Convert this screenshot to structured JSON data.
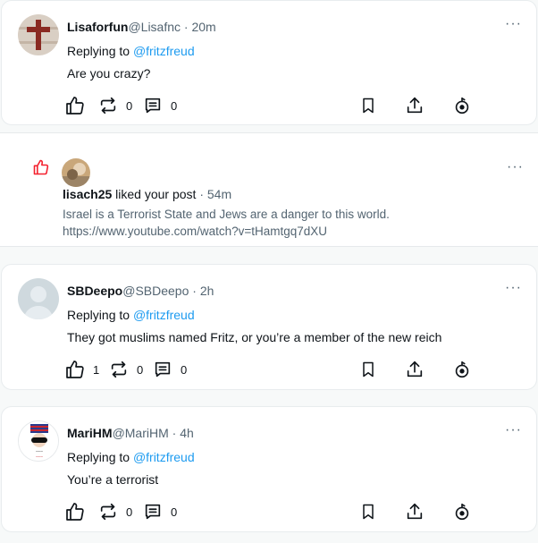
{
  "posts": [
    {
      "name": "Lisaforfun",
      "handle": "@Lisafnc",
      "time": "· 20m",
      "replying_prefix": "Replying to ",
      "replying_to": "@fritzfreud",
      "text": "Are you crazy?",
      "likes": "",
      "reposts": "0",
      "replies": "0",
      "avatar": "cross-avatar"
    },
    {
      "name": "SBDeepo",
      "handle": "@SBDeepo",
      "time": "· 2h",
      "replying_prefix": "Replying to ",
      "replying_to": "@fritzfreud",
      "text": "They got muslims named Fritz, or you’re a member of the new reich",
      "likes": "1",
      "reposts": "0",
      "replies": "0",
      "avatar": "default-avatar"
    },
    {
      "name": "MariHM",
      "handle": "@MariHM",
      "time": "· 4h",
      "replying_prefix": "Replying to ",
      "replying_to": "@fritzfreud",
      "text": "You’re a terrorist",
      "likes": "",
      "reposts": "0",
      "replies": "0",
      "avatar": "flag-avatar"
    }
  ],
  "notification": {
    "user": "lisach25",
    "action": " liked your post",
    "time": " · 54m",
    "body_line1": "Israel is a Terrorist State and Jews are a danger to this world.",
    "body_line2": "https://www.youtube.com/watch?v=tHamtgq7dXU"
  },
  "more_label": "···",
  "colors": {
    "link": "#1d9bf0",
    "like_red": "#f4212e",
    "muted": "#536471"
  }
}
